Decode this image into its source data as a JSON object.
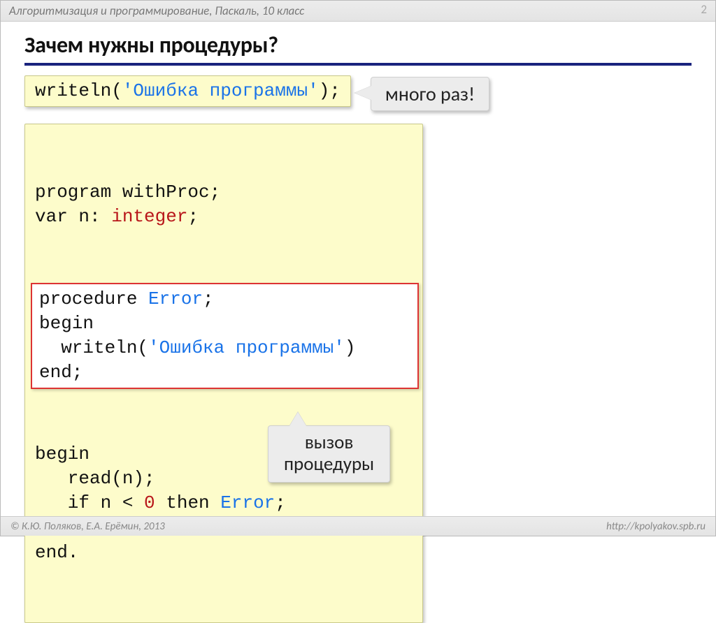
{
  "header": {
    "breadcrumb": "Алгоритмизация и программирование, Паскаль, 10 класс",
    "page_number": "2"
  },
  "title": "Зачем нужны процедуры?",
  "snippet1": {
    "tokens": [
      {
        "t": "writeln(",
        "c": "kw-black"
      },
      {
        "t": "'Ошибка программы'",
        "c": "kw-str"
      },
      {
        "t": ");",
        "c": "kw-black"
      }
    ]
  },
  "callout_top": "много раз!",
  "bigcode": {
    "top_lines": [
      [
        {
          "t": "program withProc;",
          "c": "kw-black"
        }
      ],
      [
        {
          "t": "var n: ",
          "c": "kw-black"
        },
        {
          "t": "integer",
          "c": "kw-type"
        },
        {
          "t": ";",
          "c": "kw-black"
        }
      ]
    ],
    "proc_lines": [
      [
        {
          "t": "procedure ",
          "c": "kw-black"
        },
        {
          "t": "Error",
          "c": "kw-blue"
        },
        {
          "t": ";",
          "c": "kw-black"
        }
      ],
      [
        {
          "t": "begin",
          "c": "kw-black"
        }
      ],
      [
        {
          "t": "  writeln(",
          "c": "kw-black"
        },
        {
          "t": "'Ошибка программы'",
          "c": "kw-str"
        },
        {
          "t": ")",
          "c": "kw-black"
        }
      ],
      [
        {
          "t": "end;",
          "c": "kw-black"
        }
      ]
    ],
    "bottom_lines": [
      [
        {
          "t": "begin",
          "c": "kw-black"
        }
      ],
      [
        {
          "t": "   read(n);",
          "c": "kw-black"
        }
      ],
      [
        {
          "t": "   if n < ",
          "c": "kw-black"
        },
        {
          "t": "0",
          "c": "kw-num"
        },
        {
          "t": " then ",
          "c": "kw-black"
        },
        {
          "t": "Error",
          "c": "kw-blue"
        },
        {
          "t": ";",
          "c": "kw-black"
        }
      ],
      [
        {
          "t": "   ...",
          "c": "kw-black"
        }
      ],
      [
        {
          "t": "end.",
          "c": "kw-black"
        }
      ]
    ]
  },
  "callout_bottom_l1": "вызов",
  "callout_bottom_l2": "процедуры",
  "footer": {
    "left": "© К.Ю. Поляков, Е.А. Ерёмин, 2013",
    "right": "http://kpolyakov.spb.ru"
  }
}
